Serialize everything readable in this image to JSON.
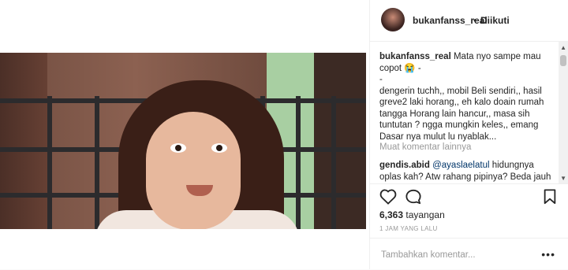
{
  "post": {
    "username": "bukanfanss_real",
    "follow_separator": "•",
    "follow_status": "Diikuti"
  },
  "caption": {
    "username": "bukanfanss_real",
    "text_line1": "Mata nyo sampe mau copot",
    "emoji": "😭",
    "after_emoji": " -",
    "dash": "-",
    "body": "dengerin tuchh,, mobil Beli sendiri,, hasil greve2 laki horang,, eh kalo doain rumah tangga Horang lain hancur,, masa sih tuntutan ? ngga mungkin keles,, emang Dasar nya mulut lu nyablak..."
  },
  "comments": {
    "load_more": "Muat komentar lainnya",
    "items": [
      {
        "username": "gendis.abid",
        "mention": "@ayaslaelatul",
        "text": " hidungnya oplas kah? Atw rahang pipinya? Beda jauh"
      }
    ]
  },
  "stats": {
    "views_count": "6,363",
    "views_label": "tayangan",
    "time_ago": "1 JAM YANG LALU"
  },
  "add_comment": {
    "placeholder": "Tambahkan komentar..."
  },
  "icons": {
    "like": "heart-icon",
    "comment": "comment-bubble-icon",
    "save": "bookmark-icon",
    "more": "more-options-icon"
  }
}
